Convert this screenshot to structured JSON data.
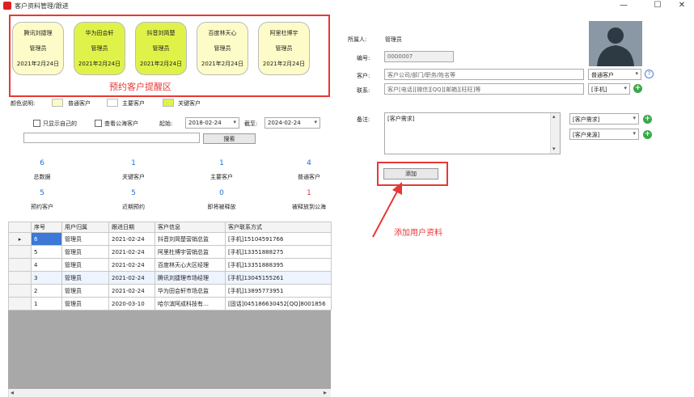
{
  "window": {
    "title": "客户资料管理/跟进",
    "min": "—",
    "max": "☐",
    "close": "✕"
  },
  "reserved_cards": [
    {
      "name": "腾讯刘捷理",
      "owner": "管理员",
      "date": "2021年2月24日",
      "type": "normal"
    },
    {
      "name": "华为田会轩",
      "owner": "管理员",
      "date": "2021年2月24日",
      "type": "key"
    },
    {
      "name": "抖音刘简楚",
      "owner": "管理员",
      "date": "2021年2月24日",
      "type": "key"
    },
    {
      "name": "百度林天心",
      "owner": "管理员",
      "date": "2021年2月24日",
      "type": "normal"
    },
    {
      "name": "阿里杜博宇",
      "owner": "管理员",
      "date": "2021年2月24日",
      "type": "normal"
    }
  ],
  "annotations": {
    "reserve_area": "预约客户提醒区",
    "add_customer": "添加用户资料"
  },
  "legend": {
    "title": "颜色说明:",
    "normal": "普通客户",
    "main": "主要客户",
    "key": "关键客户",
    "colors": {
      "normal": "#fdfcc8",
      "main": "#ffffff",
      "key": "#dff24a"
    }
  },
  "filters": {
    "only_mine": "只显示自己的",
    "view_public": "查看公海客户",
    "from_label": "起始:",
    "from_date": "2018-02-24",
    "to_label": "截至:",
    "to_date": "2024-02-24",
    "search_value": "",
    "search_button": "搜索"
  },
  "stats": [
    {
      "value": "6",
      "label": "总数据",
      "color": "#1f6fd4"
    },
    {
      "value": "1",
      "label": "关键客户",
      "color": "#1f6fd4"
    },
    {
      "value": "1",
      "label": "主要客户",
      "color": "#1f6fd4"
    },
    {
      "value": "4",
      "label": "普通客户",
      "color": "#1f6fd4"
    },
    {
      "value": "5",
      "label": "预约客户",
      "color": "#1f6fd4"
    },
    {
      "value": "5",
      "label": "近期预约",
      "color": "#1f6fd4"
    },
    {
      "value": "0",
      "label": "即将被释放",
      "color": "#1f6fd4"
    },
    {
      "value": "1",
      "label": "被释放到公海",
      "color": "#e53935"
    }
  ],
  "grid": {
    "headers": [
      "序号",
      "用户归属",
      "跟进日期",
      "客户信息",
      "客户联系方式"
    ],
    "rows": [
      [
        "6",
        "管理员",
        "2021-02-24",
        "抖音刘简楚营销总监",
        "[手机]15104591766"
      ],
      [
        "5",
        "管理员",
        "2021-02-24",
        "阿里杜博宇营销总监",
        "[手机]13351888275"
      ],
      [
        "4",
        "管理员",
        "2021-02-24",
        "百度林天心大区经理",
        "[手机]13351888395"
      ],
      [
        "3",
        "管理员",
        "2021-02-24",
        "腾讯刘捷理市场经理",
        "[手机]13045155261"
      ],
      [
        "2",
        "管理员",
        "2021-02-24",
        "华为田会轩市场总监",
        "[手机]13895773951"
      ],
      [
        "1",
        "管理员",
        "2020-03-10",
        "哈尔滨阿成科技有…",
        "[固话]045186630452[QQ]8001856"
      ]
    ]
  },
  "form": {
    "owner_label": "所属人:",
    "owner_value": "管理员",
    "id_label": "编号:",
    "id_value": "0000007",
    "customer_label": "客户:",
    "customer_placeholder": "客户公司/部门/职务/姓名等",
    "customer_type": "普通客户",
    "contact_label": "联系:",
    "contact_placeholder": "客户[电话][微信][QQ][邮箱][旺旺]等",
    "contact_type": "[手机]",
    "note_label": "备注:",
    "note_value": "[客户需求]",
    "need_type": "[客户需求]",
    "source_type": "[客户来源]",
    "add_button": "添加"
  },
  "icons": {
    "dropdown": "▾",
    "plus": "+",
    "help": "?",
    "row_pointer": "▸",
    "arrow_left": "◂",
    "arrow_right": "▸",
    "arrow_up": "▴",
    "arrow_down": "▾"
  }
}
